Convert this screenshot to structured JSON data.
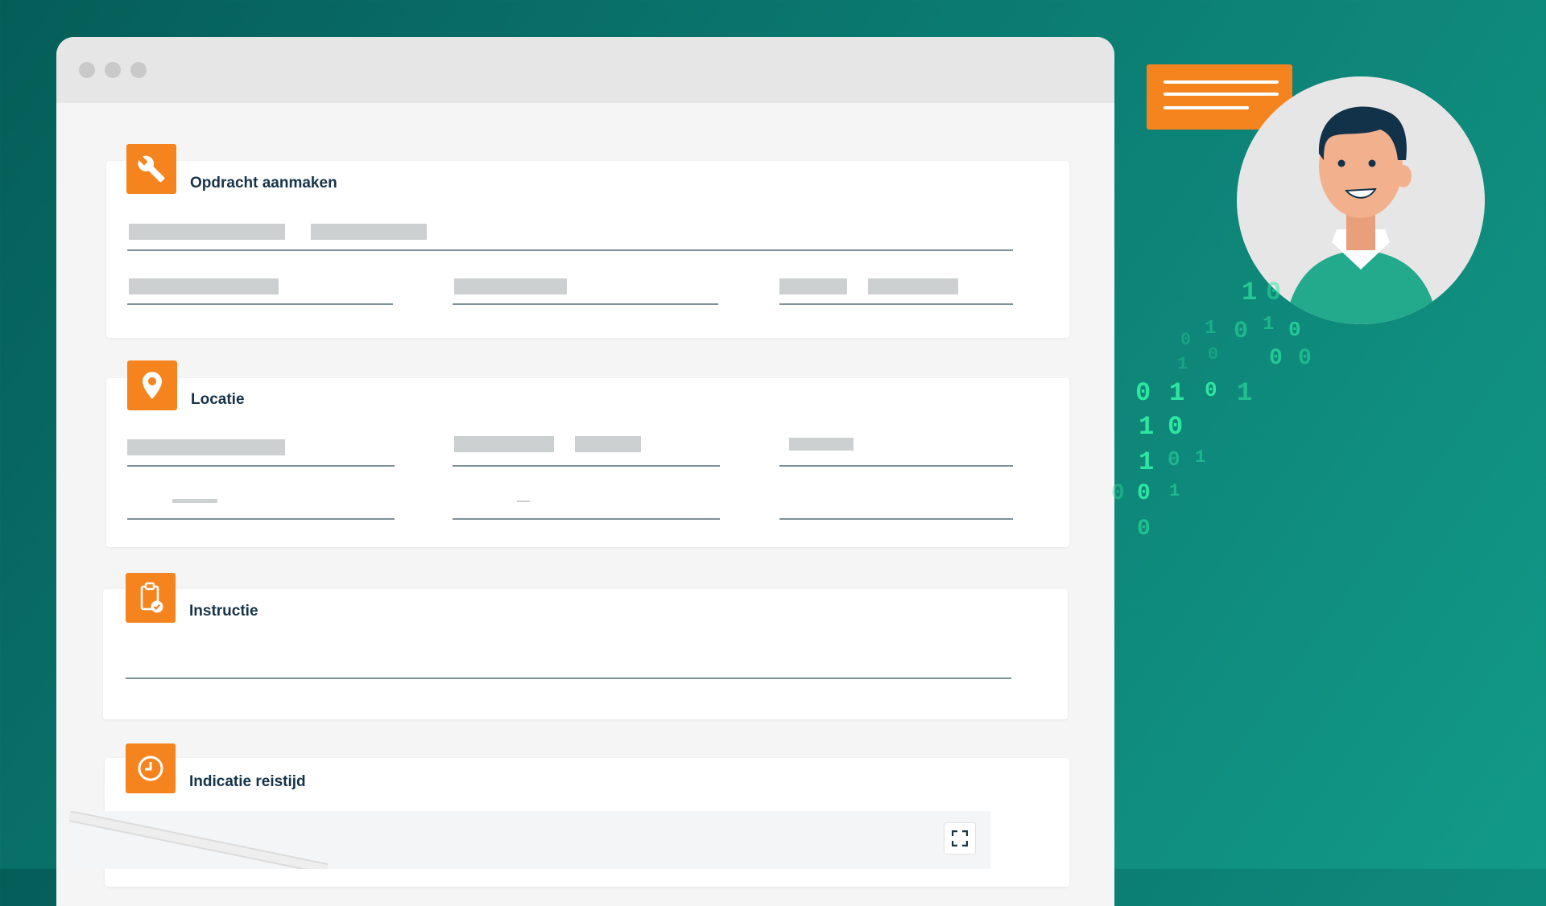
{
  "cards": {
    "assignment": {
      "title": "Opdracht aanmaken",
      "icon": "wrench-icon"
    },
    "location": {
      "title": "Locatie",
      "icon": "map-pin-icon"
    },
    "instruction": {
      "title": "Instructie",
      "icon": "clipboard-check-icon"
    },
    "travel_time": {
      "title": "Indicatie reistijd",
      "icon": "clock-icon"
    }
  },
  "map": {
    "expand_icon": "expand-icon"
  },
  "decor": {
    "binary_digits": [
      "1",
      "0",
      "1",
      "0",
      "1",
      "0",
      "0",
      "0",
      "0",
      "0",
      "1",
      "0",
      "1",
      "0",
      "1",
      "1",
      "0",
      "1",
      "0",
      "1",
      "0",
      "1",
      "0",
      "0"
    ],
    "colors": {
      "accent": "#f5841f",
      "background": "#0b7a70",
      "binary": "#2ee6a0",
      "title": "#16334a"
    }
  }
}
